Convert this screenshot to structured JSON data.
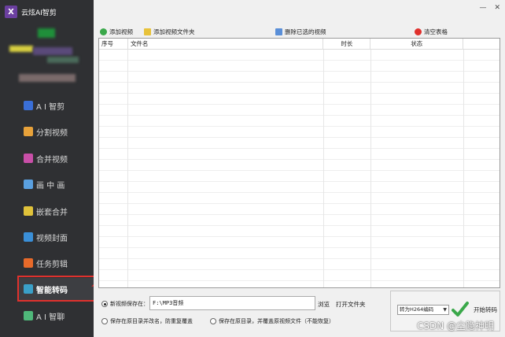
{
  "app": {
    "title": "云炫AI智剪",
    "logo_letter": "X"
  },
  "window": {
    "minimize": "—",
    "close": "✕"
  },
  "sidebar": {
    "items": [
      {
        "label": "A I 智剪",
        "icon": "scissors-icon",
        "color": "#3a6fd8"
      },
      {
        "label": "分割视频",
        "icon": "split-video-icon",
        "color": "#e8a23a"
      },
      {
        "label": "合并视频",
        "icon": "merge-video-icon",
        "color": "#c94fa8"
      },
      {
        "label": "画 中 画",
        "icon": "picture-in-picture-icon",
        "color": "#5aa0e0"
      },
      {
        "label": "嵌套合并",
        "icon": "nest-merge-icon",
        "color": "#e0c23a"
      },
      {
        "label": "视频封面",
        "icon": "cover-icon",
        "color": "#3a8fd8"
      },
      {
        "label": "任务剪辑",
        "icon": "task-edit-icon",
        "color": "#e86a2a"
      },
      {
        "label": "智能转码",
        "icon": "transcode-icon",
        "color": "#3aa0c8"
      },
      {
        "label": "A I 智聊",
        "icon": "chat-icon",
        "color": "#4fb87a"
      }
    ],
    "active_index": 7
  },
  "toolbar": {
    "add_video": "添加视频",
    "add_folder": "添加视频文件夹",
    "delete_selected": "删除已选的视频",
    "clear_table": "清空表格"
  },
  "table": {
    "columns": [
      "序号",
      "文件名",
      "时长",
      "状态"
    ],
    "rows": []
  },
  "output": {
    "new_save_label": "新视频保存在：",
    "path_value": "F:\\MP3音频",
    "browse": "浏览",
    "open_folder": "打开文件夹",
    "option_rename": "保存在原目录并改名，防重复覆盖",
    "option_overwrite": "保存在原目录，并覆盖原视频文件（不能恢复）",
    "selected_option": "new"
  },
  "encode": {
    "selected": "转为H264编码",
    "start_label": "开始转码"
  },
  "watermark": "CSDN @尘隐神明",
  "colors": {
    "sidebar_bg": "#2f3033",
    "highlight": "#e0312d",
    "accent_green": "#3aa84a"
  }
}
